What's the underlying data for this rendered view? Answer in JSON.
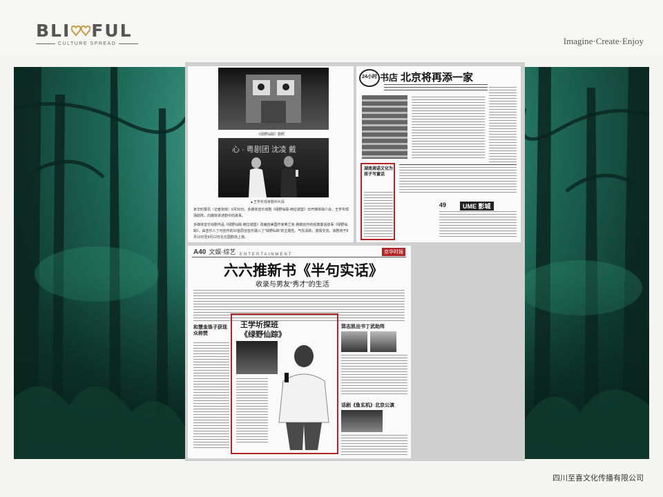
{
  "brand": {
    "logo_text_left": "BLI",
    "logo_text_right": "FUL",
    "logo_sub": "CULTURE SPREAD",
    "tagline": "Imagine·Create·Enjoy"
  },
  "footer": {
    "company": "四川至喜文化传播有限公司"
  },
  "clippings": {
    "top_left": {
      "photo_top_caption": "《绿野仙踪》剧照",
      "stage_banner": "心 · 粤剧团    沈凌  戴",
      "photo_bottom_caption": "▲王学圻现身剧中片段",
      "body_p1": "京华时报讯（记者张晓）6月30日，多媒体音乐戏剧《绿野仙踪-西拉城堡》日开媒体操介会，王学圻现场助阵，向媒体讲述剧中的故事。",
      "body_p2": "多媒体音乐戏剧作品《绿野仙踪-西拉城堡》改编自美国作家弗兰克·鲍姆创作的经典童话故事《绿野仙踪》，由音乐人丁可创作的10首原创音乐融入了“绿野仙踪”的主题性，气氛清新，激情交流。该剧将于8月10日至8月12日在北国剧场上演。"
    },
    "top_right": {
      "badge": "24小时",
      "headline_prefix": "书店",
      "headline": "北京将再添一家",
      "inset_red": "湖南湘语文化为孩子写童话",
      "bottom_banner": "UME 影城",
      "bottom_tag": "49"
    },
    "bottom": {
      "page_no": "A40",
      "section": "文娱·综艺",
      "section_en": "ENTERTAINMENT",
      "red_tag": "京华时报",
      "headline": "六六推新书《半句实话》",
      "subheadline": "收录与男友“秀才”的生活",
      "left_story_title": "和慧金珠子获现众称赞",
      "feature_title_1": "王学圻探班",
      "feature_title_2": "《绿野仙踪》",
      "right_story_1": "郭志凯出书丁武助阵",
      "right_story_2": "话剧《鱼玄机》北京公演"
    }
  }
}
